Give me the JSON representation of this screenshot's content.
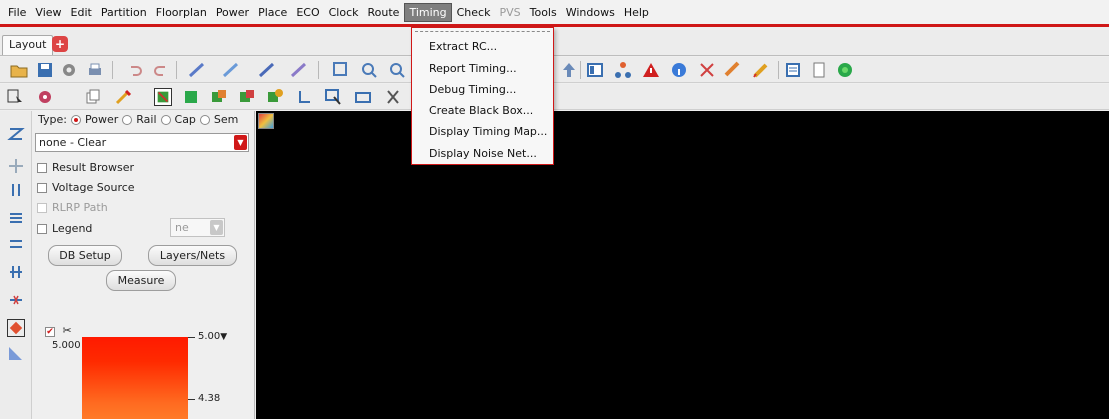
{
  "menubar": {
    "items": [
      {
        "label": "File",
        "state": "normal"
      },
      {
        "label": "View",
        "state": "normal"
      },
      {
        "label": "Edit",
        "state": "normal"
      },
      {
        "label": "Partition",
        "state": "normal"
      },
      {
        "label": "Floorplan",
        "state": "normal"
      },
      {
        "label": "Power",
        "state": "normal"
      },
      {
        "label": "Place",
        "state": "normal"
      },
      {
        "label": "ECO",
        "state": "normal"
      },
      {
        "label": "Clock",
        "state": "normal"
      },
      {
        "label": "Route",
        "state": "normal"
      },
      {
        "label": "Timing",
        "state": "active"
      },
      {
        "label": "Check",
        "state": "normal"
      },
      {
        "label": "PVS",
        "state": "disabled"
      },
      {
        "label": "Tools",
        "state": "normal"
      },
      {
        "label": "Windows",
        "state": "normal"
      },
      {
        "label": "Help",
        "state": "normal"
      }
    ]
  },
  "tabs": {
    "active": "Layout",
    "add_icon": "plus-icon"
  },
  "timing_menu": {
    "items": [
      "Extract RC...",
      "Report Timing...",
      "Debug Timing...",
      "Create Black Box...",
      "Display Timing Map...",
      "Display Noise Net..."
    ]
  },
  "panel": {
    "type_label": "Type:",
    "type_options": [
      "Power",
      "Rail",
      "Cap",
      "Sem"
    ],
    "type_selected": "Power",
    "combo_value": "none - Clear",
    "checkboxes": [
      {
        "label": "Result Browser",
        "enabled": true
      },
      {
        "label": "Voltage Source",
        "enabled": true
      },
      {
        "label": "RLRP Path",
        "enabled": false
      },
      {
        "label": "Legend",
        "enabled": true
      }
    ],
    "legend_combo": "ne",
    "buttons": {
      "db_setup": "DB Setup",
      "layers_nets": "Layers/Nets",
      "measure": "Measure"
    },
    "scale": {
      "top_left": "5.000",
      "top_right": "5.00",
      "mid": "4.38"
    }
  },
  "colors": {
    "accent": "#d01818",
    "canvas": "#000000",
    "scale_top": "#ff1a00",
    "scale_bottom": "#ff7a28"
  }
}
